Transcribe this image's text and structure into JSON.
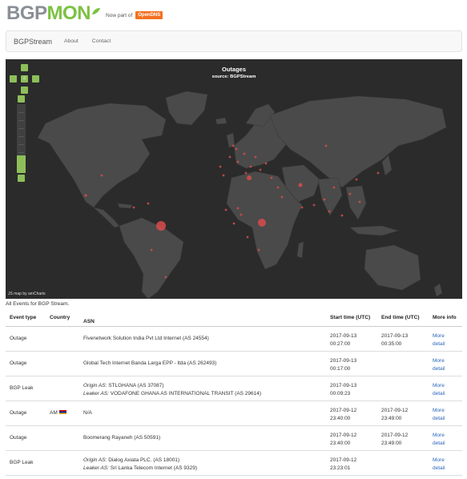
{
  "header": {
    "logo_part1": "BGP",
    "logo_part2": "MON",
    "now_part_of": "Now part of",
    "partner_logo": "OpenDNS"
  },
  "navbar": {
    "brand": "BGPStream",
    "links": [
      "About",
      "Contact"
    ]
  },
  "map": {
    "title": "Outages",
    "subtitle": "source: BGPStream",
    "credit": "JS map by amCharts",
    "colors": {
      "background": "#2b2b2b",
      "land": "#4a4a4a",
      "marker": "#d94b4b",
      "controls": "#8ebe5a"
    },
    "controls": [
      "pan-up",
      "pan-left",
      "home",
      "pan-right",
      "pan-down",
      "zoom-in",
      "zoom-slider",
      "zoom-out"
    ]
  },
  "caption": "All Events for BGP Stream.",
  "table": {
    "headers": [
      "Event type",
      "Country",
      "ASN",
      "Start time (UTC)",
      "End time (UTC)",
      "More info"
    ],
    "link_text": [
      "More",
      "detail"
    ],
    "rows": [
      {
        "event_type": "Outage",
        "country": "",
        "asn": "Fivenetwork Solution India Pvt Ltd Internet (AS 24554)",
        "start_date": "2017-09-13",
        "start_time": "00:27:00",
        "end_date": "2017-09-13",
        "end_time": "00:35:00"
      },
      {
        "event_type": "Outage",
        "country": "",
        "asn": "Global Tech Internet Banda Larga EPP - ltda (AS 262493)",
        "start_date": "2017-09-13",
        "start_time": "00:17:00",
        "end_date": "",
        "end_time": ""
      },
      {
        "event_type": "BGP Leak",
        "country": "",
        "origin_label": "Origin AS:",
        "origin": "STLGHANA (AS 37087)",
        "leaker_label": "Leaker AS:",
        "leaker": "VODAFONE GHANA AS INTERNATIONAL TRANSIT (AS 29614)",
        "start_date": "2017-09-13",
        "start_time": "00:09:23",
        "end_date": "",
        "end_time": ""
      },
      {
        "event_type": "Outage",
        "country": "AM",
        "asn": "N/A",
        "start_date": "2017-09-12",
        "start_time": "23:40:00",
        "end_date": "2017-09-12",
        "end_time": "23:49:00"
      },
      {
        "event_type": "Outage",
        "country": "",
        "asn": "Boomerang Rayaneh (AS 50591)",
        "start_date": "2017-09-12",
        "start_time": "23:40:00",
        "end_date": "2017-09-12",
        "end_time": "23:49:00"
      },
      {
        "event_type": "BGP Leak",
        "country": "",
        "origin_label": "Origin AS:",
        "origin": "Dialog Axiata PLC. (AS 18001)",
        "leaker_label": "Leaker AS:",
        "leaker": "Sri Lanka Telecom Internet (AS 9329)",
        "start_date": "2017-09-12",
        "start_time": "23:23:01",
        "end_date": "",
        "end_time": ""
      }
    ]
  }
}
